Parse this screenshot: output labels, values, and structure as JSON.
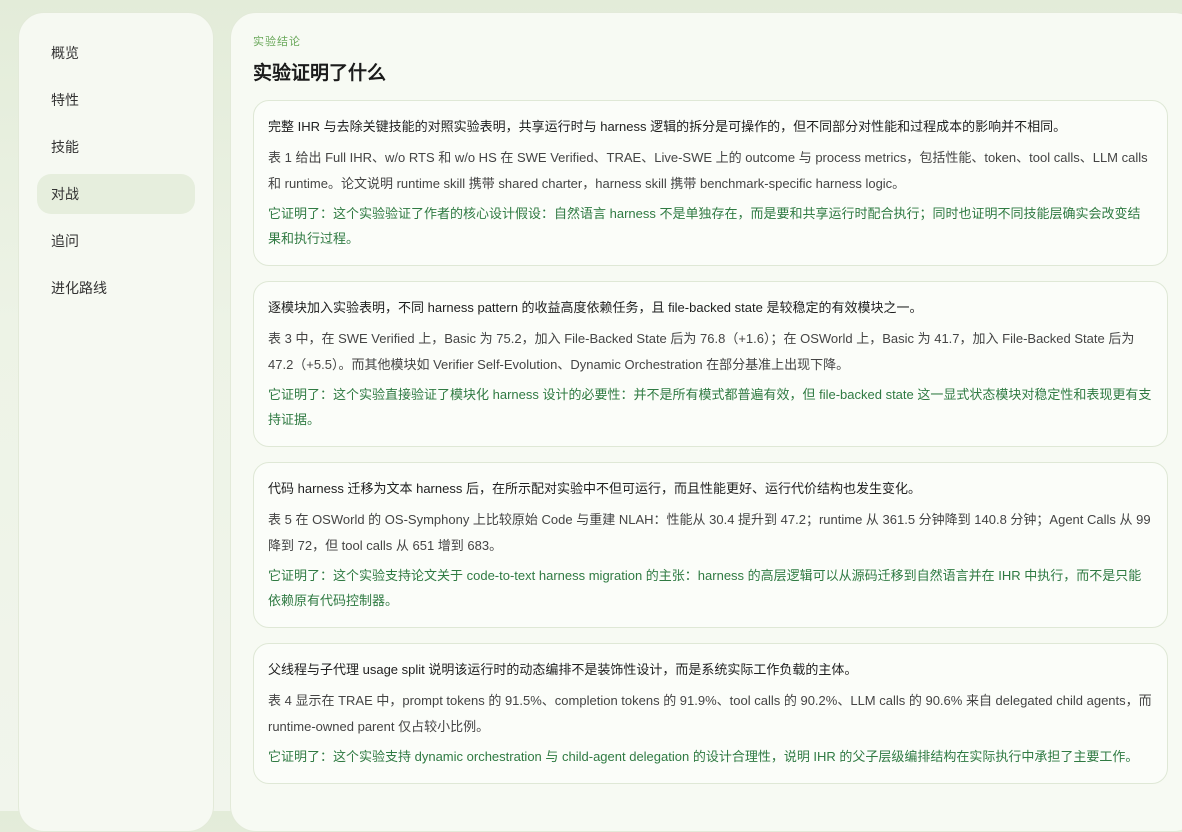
{
  "sidebar": {
    "items": [
      {
        "label": "概览"
      },
      {
        "label": "特性"
      },
      {
        "label": "技能"
      },
      {
        "label": "对战"
      },
      {
        "label": "追问"
      },
      {
        "label": "进化路线"
      }
    ],
    "active_index": 3
  },
  "main": {
    "eyebrow": "实验结论",
    "title": "实验证明了什么",
    "cards": [
      {
        "claim": "完整 IHR 与去除关键技能的对照实验表明，共享运行时与 harness 逻辑的拆分是可操作的，但不同部分对性能和过程成本的影响并不相同。",
        "evidence": "表 1 给出 Full IHR、w/o RTS 和 w/o HS 在 SWE Verified、TRAE、Live-SWE 上的 outcome 与 process metrics，包括性能、token、tool calls、LLM calls 和 runtime。论文说明 runtime skill 携带 shared charter，harness skill 携带 benchmark-specific harness logic。",
        "proof": "它证明了：这个实验验证了作者的核心设计假设：自然语言 harness 不是单独存在，而是要和共享运行时配合执行；同时也证明不同技能层确实会改变结果和执行过程。"
      },
      {
        "claim": "逐模块加入实验表明，不同 harness pattern 的收益高度依赖任务，且 file-backed state 是较稳定的有效模块之一。",
        "evidence": "表 3 中，在 SWE Verified 上，Basic 为 75.2，加入 File-Backed State 后为 76.8（+1.6）；在 OSWorld 上，Basic 为 41.7，加入 File-Backed State 后为 47.2（+5.5）。而其他模块如 Verifier Self-Evolution、Dynamic Orchestration 在部分基准上出现下降。",
        "proof": "它证明了：这个实验直接验证了模块化 harness 设计的必要性：并不是所有模式都普遍有效，但 file-backed state 这一显式状态模块对稳定性和表现更有支持证据。"
      },
      {
        "claim": "代码 harness 迁移为文本 harness 后，在所示配对实验中不但可运行，而且性能更好、运行代价结构也发生变化。",
        "evidence": "表 5 在 OSWorld 的 OS-Symphony 上比较原始 Code 与重建 NLAH：性能从 30.4 提升到 47.2；runtime 从 361.5 分钟降到 140.8 分钟；Agent Calls 从 99 降到 72，但 tool calls 从 651 增到 683。",
        "proof": "它证明了：这个实验支持论文关于 code-to-text harness migration 的主张：harness 的高层逻辑可以从源码迁移到自然语言并在 IHR 中执行，而不是只能依赖原有代码控制器。"
      },
      {
        "claim": "父线程与子代理 usage split 说明该运行时的动态编排不是装饰性设计，而是系统实际工作负载的主体。",
        "evidence": "表 4 显示在 TRAE 中，prompt tokens 的 91.5%、completion tokens 的 91.9%、tool calls 的 90.2%、LLM calls 的 90.6% 来自 delegated child agents，而 runtime-owned parent 仅占较小比例。",
        "proof": "它证明了：这个实验支持 dynamic orchestration 与 child-agent delegation 的设计合理性，说明 IHR 的父子层级编排结构在实际执行中承担了主要工作。"
      }
    ]
  }
}
